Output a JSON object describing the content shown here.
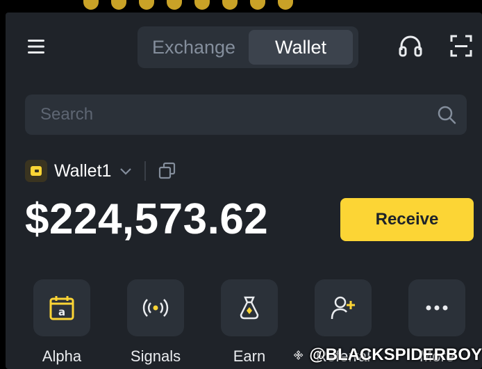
{
  "header": {
    "tabs": [
      {
        "label": "Exchange",
        "active": false
      },
      {
        "label": "Wallet",
        "active": true
      }
    ]
  },
  "search": {
    "placeholder": "Search"
  },
  "wallet": {
    "name": "Wallet1",
    "balance": "$224,573.62",
    "receive_label": "Receive"
  },
  "actions": [
    {
      "label": "Alpha",
      "icon": "alpha-calendar-icon"
    },
    {
      "label": "Signals",
      "icon": "signals-broadcast-icon"
    },
    {
      "label": "Earn",
      "icon": "money-bag-icon"
    },
    {
      "label": "Referral",
      "icon": "add-user-icon"
    },
    {
      "label": "More",
      "icon": "more-dots-icon"
    }
  ],
  "watermark": {
    "text": "@BLACKSPIDERBOY",
    "icon": "binance-logo-icon"
  },
  "colors": {
    "background": "#1f2329",
    "surface": "#2b3139",
    "accent": "#fcd535",
    "text": "#eaecef",
    "muted": "#848e9c"
  }
}
